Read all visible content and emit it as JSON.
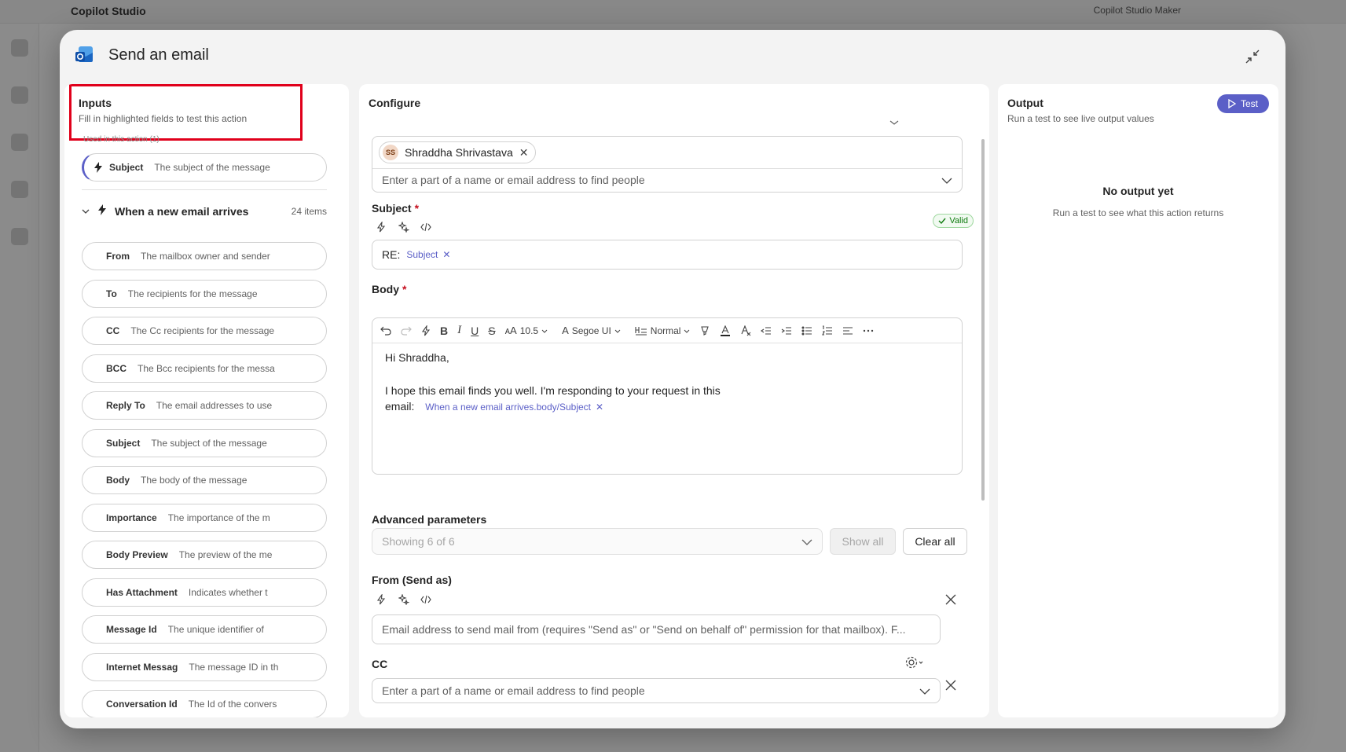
{
  "background": {
    "app_title": "Copilot Studio",
    "environment": "Copilot Studio Maker"
  },
  "dialog": {
    "title": "Send an email"
  },
  "inputs": {
    "title": "Inputs",
    "subtitle": "Fill in highlighted fields to test this action",
    "used_label": "Used in this action (1)",
    "used_item": {
      "name": "Subject",
      "desc": "The subject of the message"
    },
    "group_title": "When a new email arrives",
    "group_count": "24 items",
    "items": [
      {
        "name": "From",
        "desc": "The mailbox owner and sender"
      },
      {
        "name": "To",
        "desc": "The recipients for the message"
      },
      {
        "name": "CC",
        "desc": "The Cc recipients for the message"
      },
      {
        "name": "BCC",
        "desc": "The Bcc recipients for the messa"
      },
      {
        "name": "Reply To",
        "desc": "The email addresses to use"
      },
      {
        "name": "Subject",
        "desc": "The subject of the message"
      },
      {
        "name": "Body",
        "desc": "The body of the message"
      },
      {
        "name": "Importance",
        "desc": "The importance of the m"
      },
      {
        "name": "Body Preview",
        "desc": "The preview of the me"
      },
      {
        "name": "Has Attachment",
        "desc": "Indicates whether t"
      },
      {
        "name": "Message Id",
        "desc": "The unique identifier of"
      },
      {
        "name": "Internet Messag",
        "desc": "The message ID in th"
      },
      {
        "name": "Conversation Id",
        "desc": "The Id of the convers"
      }
    ]
  },
  "configure": {
    "title": "Configure",
    "to": {
      "chip_initials": "SS",
      "chip_name": "Shraddha Shrivastava",
      "placeholder": "Enter a part of a name or email address to find people"
    },
    "subject": {
      "label": "Subject",
      "required_mark": "*",
      "valid_label": "Valid",
      "prefix": "RE:",
      "token": "Subject"
    },
    "body": {
      "label": "Body",
      "required_mark": "*",
      "font_size": "10.5",
      "font_name": "Segoe UI",
      "style_name": "Normal",
      "line1": "Hi Shraddha,",
      "line2": "I hope this email finds you well. I'm responding to your request in this",
      "line3_prefix": "email:",
      "token": "When a new email arrives.body/Subject"
    },
    "advanced": {
      "label": "Advanced parameters",
      "select_value": "Showing 6 of 6",
      "show_all": "Show all",
      "clear_all": "Clear all"
    },
    "from": {
      "label": "From (Send as)",
      "placeholder": "Email address to send mail from (requires \"Send as\" or \"Send on behalf of\" permission for that mailbox). F..."
    },
    "cc": {
      "label": "CC",
      "placeholder": "Enter a part of a name or email address to find people"
    }
  },
  "output": {
    "title": "Output",
    "subtitle": "Run a test to see live output values",
    "test_button": "Test",
    "empty_title": "No output yet",
    "empty_sub": "Run a test to see what this action returns"
  },
  "colors": {
    "accent": "#5b5fc7",
    "highlight_border": "#e0001b",
    "valid": "#107c10",
    "required": "#c50f1f"
  }
}
